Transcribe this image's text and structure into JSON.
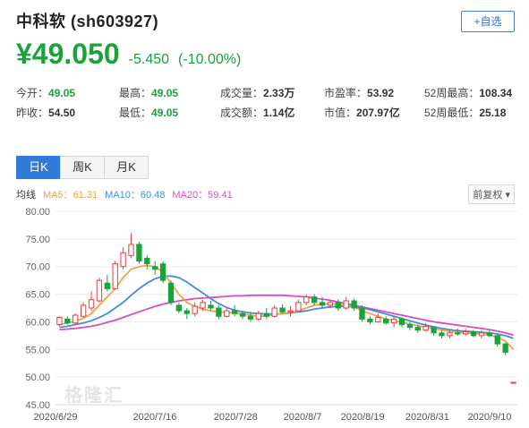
{
  "header": {
    "title": "中科软 (sh603927)",
    "add_button": "+自选"
  },
  "price": {
    "current": "¥49.050",
    "change": "-5.450",
    "percent": "(-10.00%)"
  },
  "stats": {
    "row1": [
      {
        "label": "今开：",
        "value": "49.05"
      },
      {
        "label": "最高：",
        "value": "49.05"
      },
      {
        "label": "成交量：",
        "value": "2.33万"
      },
      {
        "label": "市盈率：",
        "value": "53.92"
      },
      {
        "label": "52周最高：",
        "value": "108.34"
      }
    ],
    "row2": [
      {
        "label": "昨收：",
        "value": "54.50"
      },
      {
        "label": "最低：",
        "value": "49.05"
      },
      {
        "label": "成交额：",
        "value": "1.14亿"
      },
      {
        "label": "市值：",
        "value": "207.97亿"
      },
      {
        "label": "52周最低：",
        "value": "25.18"
      }
    ]
  },
  "tabs": [
    "日K",
    "周K",
    "月K"
  ],
  "legend": {
    "title": "均线",
    "ma5": "MA5：61.31",
    "ma10": "MA10：60.48",
    "ma20": "MA20：59.41"
  },
  "adjust": "前复权 ▾",
  "watermark": "格隆汇",
  "colors": {
    "up": "#e04040",
    "down": "#1aa33a",
    "ma5": "#f2a341",
    "ma10": "#3f8fe0",
    "ma20": "#d64fbd"
  },
  "chart_data": {
    "type": "candlestick",
    "ylim": [
      45,
      80
    ],
    "yticks": [
      "80.00",
      "75.00",
      "70.00",
      "65.00",
      "60.00",
      "55.00",
      "50.00",
      "45.00"
    ],
    "xticks": [
      "2020/6/29",
      "2020/7/16",
      "2020/7/28",
      "2020/8/7",
      "2020/8/19",
      "2020/8/31",
      "2020/9/10"
    ],
    "candles": [
      [
        59.5,
        60.8,
        59.2,
        61.0
      ],
      [
        60.5,
        59.8,
        59.5,
        61.0
      ],
      [
        59.8,
        61.2,
        59.5,
        61.5
      ],
      [
        61.0,
        63.0,
        60.8,
        63.5
      ],
      [
        62.5,
        64.0,
        62.0,
        65.5
      ],
      [
        63.8,
        67.5,
        63.5,
        68.0
      ],
      [
        67.0,
        66.0,
        65.5,
        68.5
      ],
      [
        66.0,
        70.5,
        65.8,
        71.0
      ],
      [
        70.0,
        72.5,
        69.5,
        73.5
      ],
      [
        72.0,
        74.0,
        71.5,
        76.0
      ],
      [
        74.0,
        71.0,
        70.5,
        74.5
      ],
      [
        71.5,
        70.5,
        69.5,
        72.0
      ],
      [
        70.0,
        69.5,
        68.5,
        71.0
      ],
      [
        70.5,
        67.5,
        67.0,
        71.0
      ],
      [
        67.0,
        63.5,
        63.0,
        67.5
      ],
      [
        63.0,
        62.0,
        61.5,
        63.5
      ],
      [
        62.0,
        61.5,
        60.5,
        62.5
      ],
      [
        61.5,
        62.8,
        61.0,
        63.5
      ],
      [
        62.5,
        63.5,
        62.0,
        64.0
      ],
      [
        63.0,
        62.5,
        62.0,
        63.8
      ],
      [
        62.5,
        61.0,
        60.5,
        63.0
      ],
      [
        61.0,
        62.0,
        60.8,
        62.5
      ],
      [
        62.0,
        61.5,
        61.0,
        63.0
      ],
      [
        61.5,
        61.0,
        60.5,
        62.0
      ],
      [
        61.0,
        60.5,
        60.0,
        61.8
      ],
      [
        60.5,
        61.5,
        60.2,
        62.0
      ],
      [
        61.5,
        61.0,
        60.5,
        62.5
      ],
      [
        61.0,
        62.5,
        60.8,
        63.0
      ],
      [
        62.5,
        61.8,
        61.5,
        63.2
      ],
      [
        61.8,
        62.0,
        61.0,
        62.8
      ],
      [
        62.0,
        63.5,
        61.8,
        64.0
      ],
      [
        63.5,
        64.5,
        63.0,
        65.0
      ],
      [
        64.5,
        63.5,
        63.0,
        65.0
      ],
      [
        63.5,
        63.0,
        62.5,
        64.5
      ],
      [
        63.0,
        63.5,
        62.5,
        64.0
      ],
      [
        63.5,
        62.5,
        62.0,
        64.0
      ],
      [
        62.5,
        63.8,
        62.2,
        64.5
      ],
      [
        63.8,
        62.5,
        62.0,
        64.2
      ],
      [
        62.5,
        60.5,
        60.0,
        63.0
      ],
      [
        60.5,
        60.0,
        59.5,
        61.0
      ],
      [
        60.0,
        60.8,
        59.8,
        61.5
      ],
      [
        60.5,
        59.8,
        59.5,
        61.0
      ],
      [
        59.8,
        60.5,
        59.0,
        61.0
      ],
      [
        60.5,
        59.5,
        59.0,
        60.8
      ],
      [
        59.5,
        59.0,
        58.5,
        60.0
      ],
      [
        59.0,
        58.5,
        58.0,
        59.5
      ],
      [
        58.5,
        59.2,
        58.2,
        59.8
      ],
      [
        59.0,
        58.0,
        57.5,
        59.2
      ],
      [
        58.0,
        57.5,
        57.0,
        58.5
      ],
      [
        57.5,
        58.0,
        57.0,
        58.5
      ],
      [
        58.0,
        57.8,
        57.5,
        58.8
      ],
      [
        57.8,
        58.2,
        57.5,
        58.8
      ],
      [
        58.2,
        57.5,
        57.2,
        58.5
      ],
      [
        57.5,
        58.0,
        57.0,
        58.5
      ],
      [
        58.0,
        57.5,
        57.2,
        58.5
      ],
      [
        57.5,
        56.0,
        55.5,
        57.8
      ],
      [
        56.0,
        54.5,
        54.0,
        56.2
      ],
      [
        49.05,
        49.05,
        49.05,
        49.05
      ]
    ],
    "ma5": [
      59.5,
      59.8,
      60.2,
      60.6,
      61.5,
      63.0,
      64.5,
      66.0,
      68.0,
      69.5,
      70.0,
      70.2,
      70.0,
      69.0,
      67.0,
      65.0,
      63.5,
      62.8,
      62.3,
      62.0,
      61.8,
      61.7,
      61.6,
      61.4,
      61.2,
      61.0,
      61.1,
      61.3,
      61.5,
      61.7,
      62.0,
      62.5,
      63.0,
      63.2,
      63.3,
      63.2,
      63.0,
      62.7,
      62.0,
      61.5,
      61.0,
      60.5,
      60.2,
      59.9,
      59.6,
      59.3,
      59.0,
      58.8,
      58.5,
      58.3,
      58.1,
      58.0,
      57.9,
      57.8,
      57.6,
      57.2,
      56.5,
      55.0
    ],
    "ma10": [
      59.0,
      59.2,
      59.5,
      59.8,
      60.2,
      60.8,
      61.5,
      62.5,
      63.5,
      64.8,
      66.0,
      67.0,
      67.8,
      68.2,
      68.3,
      68.0,
      67.2,
      66.2,
      65.2,
      64.2,
      63.3,
      62.6,
      62.1,
      61.8,
      61.6,
      61.5,
      61.4,
      61.4,
      61.5,
      61.6,
      61.8,
      62.0,
      62.3,
      62.5,
      62.7,
      62.8,
      62.8,
      62.7,
      62.5,
      62.2,
      61.8,
      61.4,
      61.0,
      60.6,
      60.2,
      59.8,
      59.4,
      59.1,
      58.8,
      58.6,
      58.4,
      58.3,
      58.2,
      58.1,
      58.0,
      57.8,
      57.5,
      57.0
    ],
    "ma20": [
      58.6,
      58.7,
      58.8,
      59.0,
      59.2,
      59.5,
      59.9,
      60.3,
      60.8,
      61.3,
      61.8,
      62.3,
      62.8,
      63.2,
      63.5,
      63.8,
      64.0,
      64.2,
      64.3,
      64.4,
      64.5,
      64.6,
      64.7,
      64.7,
      64.8,
      64.8,
      64.8,
      64.8,
      64.8,
      64.7,
      64.6,
      64.5,
      64.3,
      64.1,
      63.9,
      63.6,
      63.3,
      63.0,
      62.7,
      62.4,
      62.1,
      61.8,
      61.5,
      61.2,
      60.9,
      60.6,
      60.3,
      60.0,
      59.8,
      59.6,
      59.4,
      59.2,
      59.0,
      58.8,
      58.6,
      58.3,
      58.0,
      57.6
    ]
  }
}
